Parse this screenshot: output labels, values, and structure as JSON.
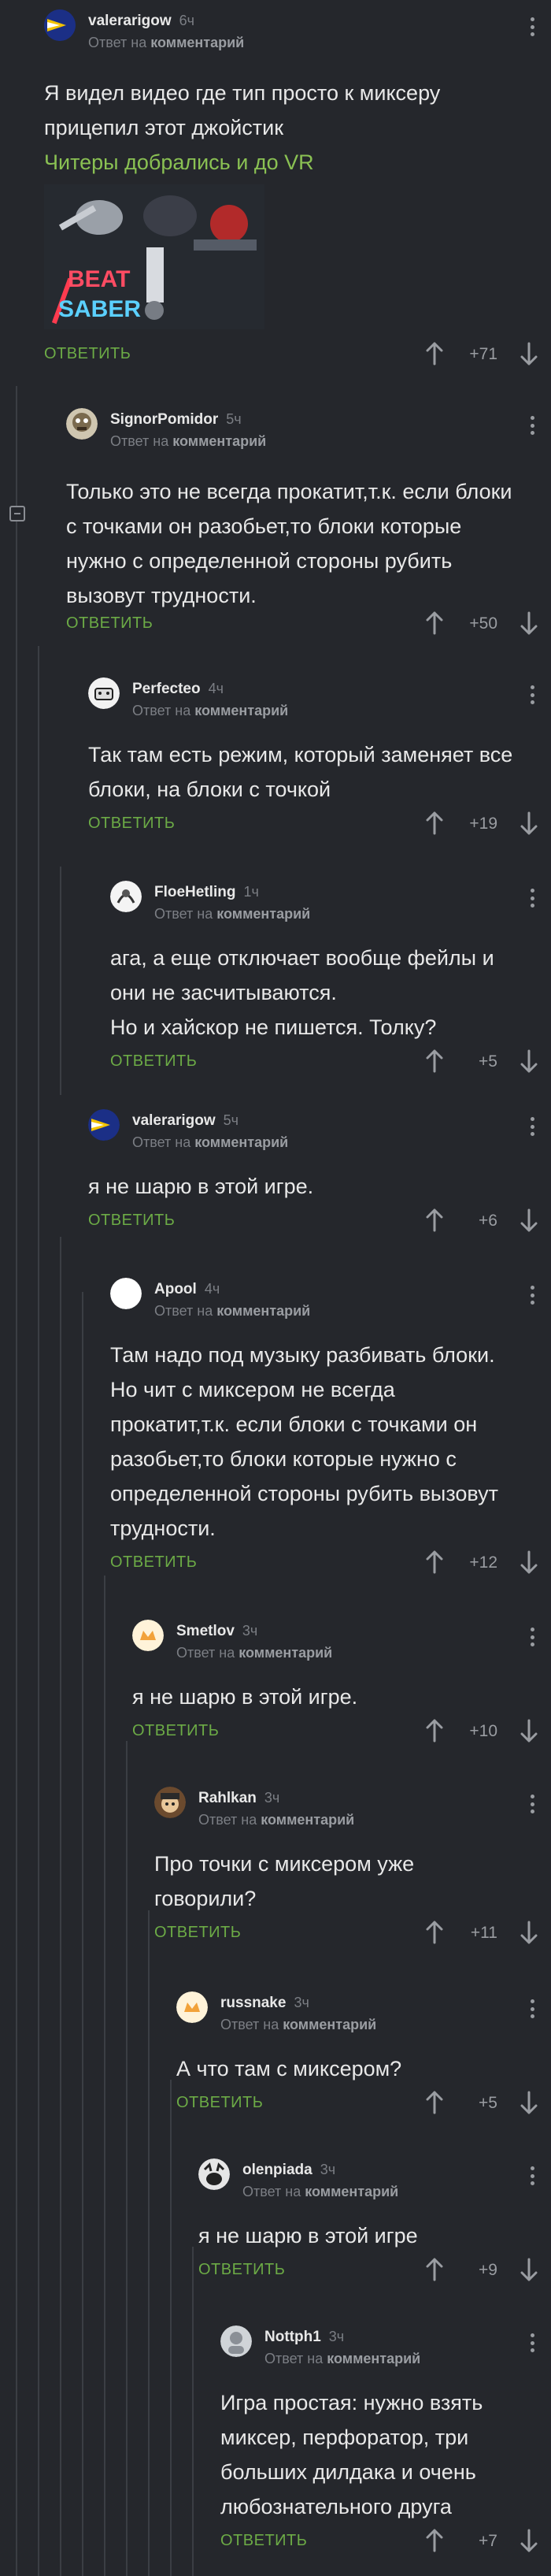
{
  "vote_icons": {
    "up": "arrow-up-icon",
    "down": "arrow-down-icon",
    "more": "more-vertical-icon",
    "collapse": "collapse-minus-icon"
  },
  "colors": {
    "background": "#25272c",
    "reply_button": "#6cab46",
    "link": "#8ac153",
    "muted": "#7b7e84"
  },
  "comments": [
    {
      "author": "valerarigow",
      "age": "6ч",
      "reply_prefix": "Ответ на",
      "reply_target": "комментарий",
      "text": "Я видел видео где тип просто к миксеру прицепил этот джойстик",
      "link": "Читеры добрались и до VR",
      "media": {
        "logo_line1": "BEAT",
        "logo_line2": "SABER"
      },
      "reply_label": "ОТВЕТИТЬ",
      "rating": "+71"
    },
    {
      "author": "SignorPomidor",
      "age": "5ч",
      "reply_prefix": "Ответ на",
      "reply_target": "комментарий",
      "text": "Только это не всегда прокатит,т.к. если блоки с точками он разобьет,то блоки которые нужно с определенной стороны рубить вызовут трудности.",
      "reply_label": "ОТВЕТИТЬ",
      "rating": "+50"
    },
    {
      "author": "Perfecteo",
      "age": "4ч",
      "reply_prefix": "Ответ на",
      "reply_target": "комментарий",
      "text": "Так там есть режим, который заменяет все блоки, на блоки с точкой",
      "reply_label": "ОТВЕТИТЬ",
      "rating": "+19"
    },
    {
      "author": "FloeHetling",
      "age": "1ч",
      "reply_prefix": "Ответ на",
      "reply_target": "комментарий",
      "text": "ага, а еще отключает вообще фейлы и они не засчитываются.\nНо и хайскор не пишется. Толку?",
      "reply_label": "ОТВЕТИТЬ",
      "rating": "+5"
    },
    {
      "author": "valerarigow",
      "age": "5ч",
      "reply_prefix": "Ответ на",
      "reply_target": "комментарий",
      "text": "я не шарю в этой игре.",
      "reply_label": "ОТВЕТИТЬ",
      "rating": "+6"
    },
    {
      "author": "Apool",
      "age": "4ч",
      "reply_prefix": "Ответ на",
      "reply_target": "комментарий",
      "text": "Там надо под музыку разбивать блоки. Но чит с миксером не всегда прокатит,т.к. если блоки с точками он разобьет,то блоки которые нужно с определенной стороны рубить вызовут трудности.",
      "reply_label": "ОТВЕТИТЬ",
      "rating": "+12"
    },
    {
      "author": "Smetlov",
      "age": "3ч",
      "reply_prefix": "Ответ на",
      "reply_target": "комментарий",
      "text": "я не шарю в этой игре.",
      "reply_label": "ОТВЕТИТЬ",
      "rating": "+10"
    },
    {
      "author": "Rahlkan",
      "age": "3ч",
      "reply_prefix": "Ответ на",
      "reply_target": "комментарий",
      "text": "Про точки с миксером уже говорили?",
      "reply_label": "ОТВЕТИТЬ",
      "rating": "+11"
    },
    {
      "author": "russnake",
      "age": "3ч",
      "reply_prefix": "Ответ на",
      "reply_target": "комментарий",
      "text": "А что там с миксером?",
      "reply_label": "ОТВЕТИТЬ",
      "rating": "+5"
    },
    {
      "author": "olenpiada",
      "age": "3ч",
      "reply_prefix": "Ответ на",
      "reply_target": "комментарий",
      "text": "я не шарю в этой игре",
      "reply_label": "ОТВЕТИТЬ",
      "rating": "+9"
    },
    {
      "author": "Nottph1",
      "age": "3ч",
      "reply_prefix": "Ответ на",
      "reply_target": "комментарий",
      "text": "Игра простая: нужно взять миксер, перфоратор, три больших дилдака и очень любознательного друга",
      "reply_label": "ОТВЕТИТЬ",
      "rating": "+7"
    }
  ]
}
